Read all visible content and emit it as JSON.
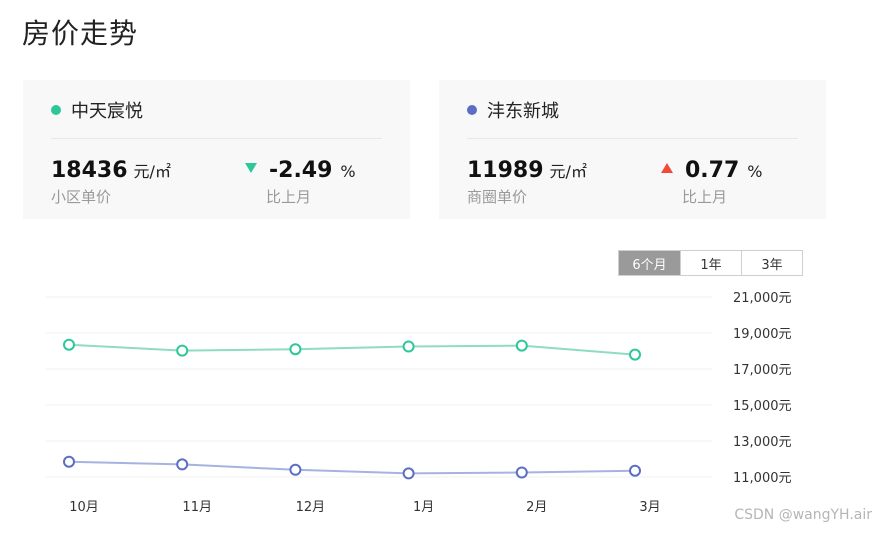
{
  "page": {
    "title": "房价走势"
  },
  "cards": [
    {
      "name": "中天宸悦",
      "color": "#2ec79a",
      "price": "18436",
      "price_unit": "元/㎡",
      "price_label": "小区单价",
      "change": "-2.49",
      "change_unit": "%",
      "change_label": "比上月",
      "direction": "down"
    },
    {
      "name": "沣东新城",
      "color": "#5b6ec4",
      "price": "11989",
      "price_unit": "元/㎡",
      "price_label": "商圈单价",
      "change": "0.77",
      "change_unit": "%",
      "change_label": "比上月",
      "direction": "up"
    }
  ],
  "range_tabs": [
    {
      "label": "6个月",
      "active": true
    },
    {
      "label": "1年",
      "active": false
    },
    {
      "label": "3年",
      "active": false
    }
  ],
  "watermark": "CSDN @wangYH.air",
  "chart_data": {
    "type": "line",
    "categories": [
      "10月",
      "11月",
      "12月",
      "1月",
      "2月",
      "3月"
    ],
    "ylim": [
      11000,
      21000
    ],
    "yticks": [
      21000,
      19000,
      17000,
      15000,
      13000,
      11000
    ],
    "ytick_labels": [
      "21,000元",
      "19,000元",
      "17,000元",
      "15,000元",
      "13,000元",
      "11,000元"
    ],
    "grid": true,
    "series": [
      {
        "name": "中天宸悦",
        "color": "#8fdcc0",
        "marker_color": "#2ec79a",
        "values": [
          18350,
          18020,
          18100,
          18250,
          18300,
          17800
        ]
      },
      {
        "name": "沣东新城",
        "color": "#a6b3e0",
        "marker_color": "#5b6ec4",
        "values": [
          11850,
          11700,
          11400,
          11200,
          11250,
          11350
        ]
      }
    ]
  }
}
